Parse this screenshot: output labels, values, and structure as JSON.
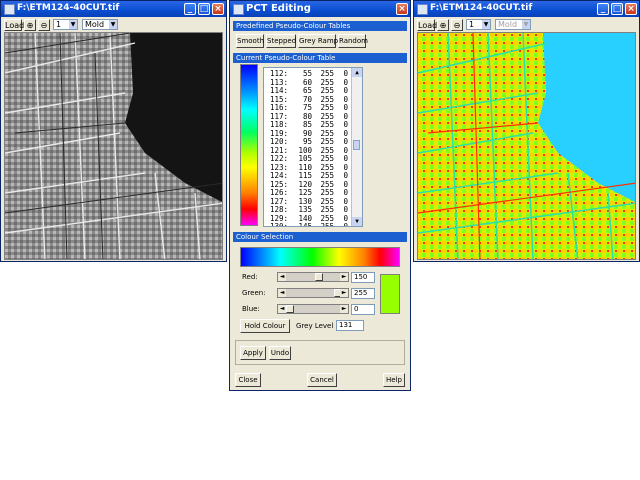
{
  "left_window": {
    "title": "F:\\ETM124-40CUT.tif",
    "load_label": "Load",
    "zoom_value": "1",
    "mode_value": "Mold"
  },
  "right_window": {
    "title": "F:\\ETM124-40CUT.tif",
    "load_label": "Load",
    "zoom_value": "1",
    "mode_value": "Mold"
  },
  "pct": {
    "title": "PCT Editing",
    "predefined_header": "Predefined Pseudo-Colour Tables",
    "buttons": [
      "Smooth",
      "Stepped",
      "Grey Ramp",
      "Random"
    ],
    "current_header": "Current Pseudo-Colour Table",
    "table_rows": [
      [
        "112:",
        "55",
        "255",
        "0"
      ],
      [
        "113:",
        "60",
        "255",
        "0"
      ],
      [
        "114:",
        "65",
        "255",
        "0"
      ],
      [
        "115:",
        "70",
        "255",
        "0"
      ],
      [
        "116:",
        "75",
        "255",
        "0"
      ],
      [
        "117:",
        "80",
        "255",
        "0"
      ],
      [
        "118:",
        "85",
        "255",
        "0"
      ],
      [
        "119:",
        "90",
        "255",
        "0"
      ],
      [
        "120:",
        "95",
        "255",
        "0"
      ],
      [
        "121:",
        "100",
        "255",
        "0"
      ],
      [
        "122:",
        "105",
        "255",
        "0"
      ],
      [
        "123:",
        "110",
        "255",
        "0"
      ],
      [
        "124:",
        "115",
        "255",
        "0"
      ],
      [
        "125:",
        "120",
        "255",
        "0"
      ],
      [
        "126:",
        "125",
        "255",
        "0"
      ],
      [
        "127:",
        "130",
        "255",
        "0"
      ],
      [
        "128:",
        "135",
        "255",
        "0"
      ],
      [
        "129:",
        "140",
        "255",
        "0"
      ],
      [
        "130:",
        "145",
        "255",
        "0"
      ]
    ],
    "colour_selection_header": "Colour Selection",
    "red_label": "Red:",
    "green_label": "Green:",
    "blue_label": "Blue:",
    "red_value": "150",
    "green_value": "255",
    "blue_value": "0",
    "red_fraction": 0.59,
    "green_fraction": 1.0,
    "blue_fraction": 0.0,
    "swatch_color": "#96ff00",
    "hold_colour_label": "Hold Colour",
    "grey_level_label": "Grey Level",
    "grey_level_value": "131",
    "apply_label": "Apply",
    "undo_label": "Undo",
    "close_label": "Close",
    "cancel_label": "Cancel",
    "help_label": "Help"
  },
  "titlebar_icons": [
    "minimize-icon",
    "maximize-icon",
    "close-icon"
  ]
}
